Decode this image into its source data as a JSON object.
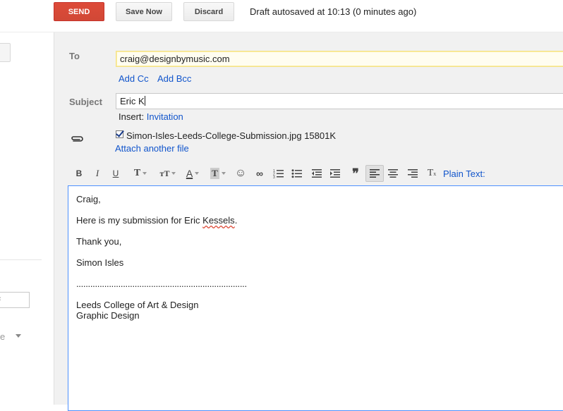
{
  "toolbar": {
    "send_label": "SEND",
    "save_now_label": "Save Now",
    "discard_label": "Discard",
    "draft_status": "Draft autosaved at 10:13 (0 minutes ago)"
  },
  "sidebar": {
    "more_label": "e"
  },
  "compose": {
    "to_label": "To",
    "to_value": "craig@designbymusic.com",
    "add_cc": "Add Cc",
    "add_bcc": "Add Bcc",
    "subject_label": "Subject",
    "subject_value": "Eric K",
    "insert_label": "Insert:",
    "insert_link": "Invitation",
    "attachment": {
      "checked": true,
      "filename": "Simon-Isles-Leeds-College-Submission.jpg",
      "size": "15801K"
    },
    "attach_another": "Attach another file"
  },
  "format_toolbar": {
    "buttons": [
      {
        "name": "bold-icon",
        "glyph": "B"
      },
      {
        "name": "italic-icon",
        "glyph": "I"
      },
      {
        "name": "underline-icon",
        "glyph": "U"
      },
      {
        "name": "font-icon",
        "glyph": "T"
      },
      {
        "name": "font-size-icon",
        "glyph": "тT"
      },
      {
        "name": "text-color-icon",
        "glyph": "A"
      },
      {
        "name": "highlight-color-icon",
        "glyph": "T"
      },
      {
        "name": "emoji-icon",
        "glyph": "☺"
      },
      {
        "name": "link-icon",
        "glyph": "∞"
      },
      {
        "name": "numbered-list-icon",
        "glyph": "≔"
      },
      {
        "name": "bulleted-list-icon",
        "glyph": "≡"
      },
      {
        "name": "indent-less-icon",
        "glyph": "⇤"
      },
      {
        "name": "indent-more-icon",
        "glyph": "⇥"
      },
      {
        "name": "quote-icon",
        "glyph": "❞"
      },
      {
        "name": "align-left-icon",
        "glyph": "≡"
      },
      {
        "name": "align-center-icon",
        "glyph": "≡"
      },
      {
        "name": "align-right-icon",
        "glyph": "≡"
      },
      {
        "name": "remove-formatting-icon",
        "glyph": "T"
      }
    ],
    "plain_text_link": "Plain Text:"
  },
  "body": {
    "greeting": "Craig,",
    "line1_pre": "Here is my submission for Eric ",
    "line1_misspelled": "Kessels",
    "line1_post": ".",
    "thanks": "Thank you,",
    "name": "Simon Isles",
    "separator": ".........................................................................",
    "org_line1": "Leeds College of Art & Design",
    "org_line2": "Graphic Design"
  },
  "colors": {
    "send": "#d14836",
    "link": "#1155cc",
    "compose_bg": "#f1f1f1",
    "editor_border": "#4d90fe"
  }
}
